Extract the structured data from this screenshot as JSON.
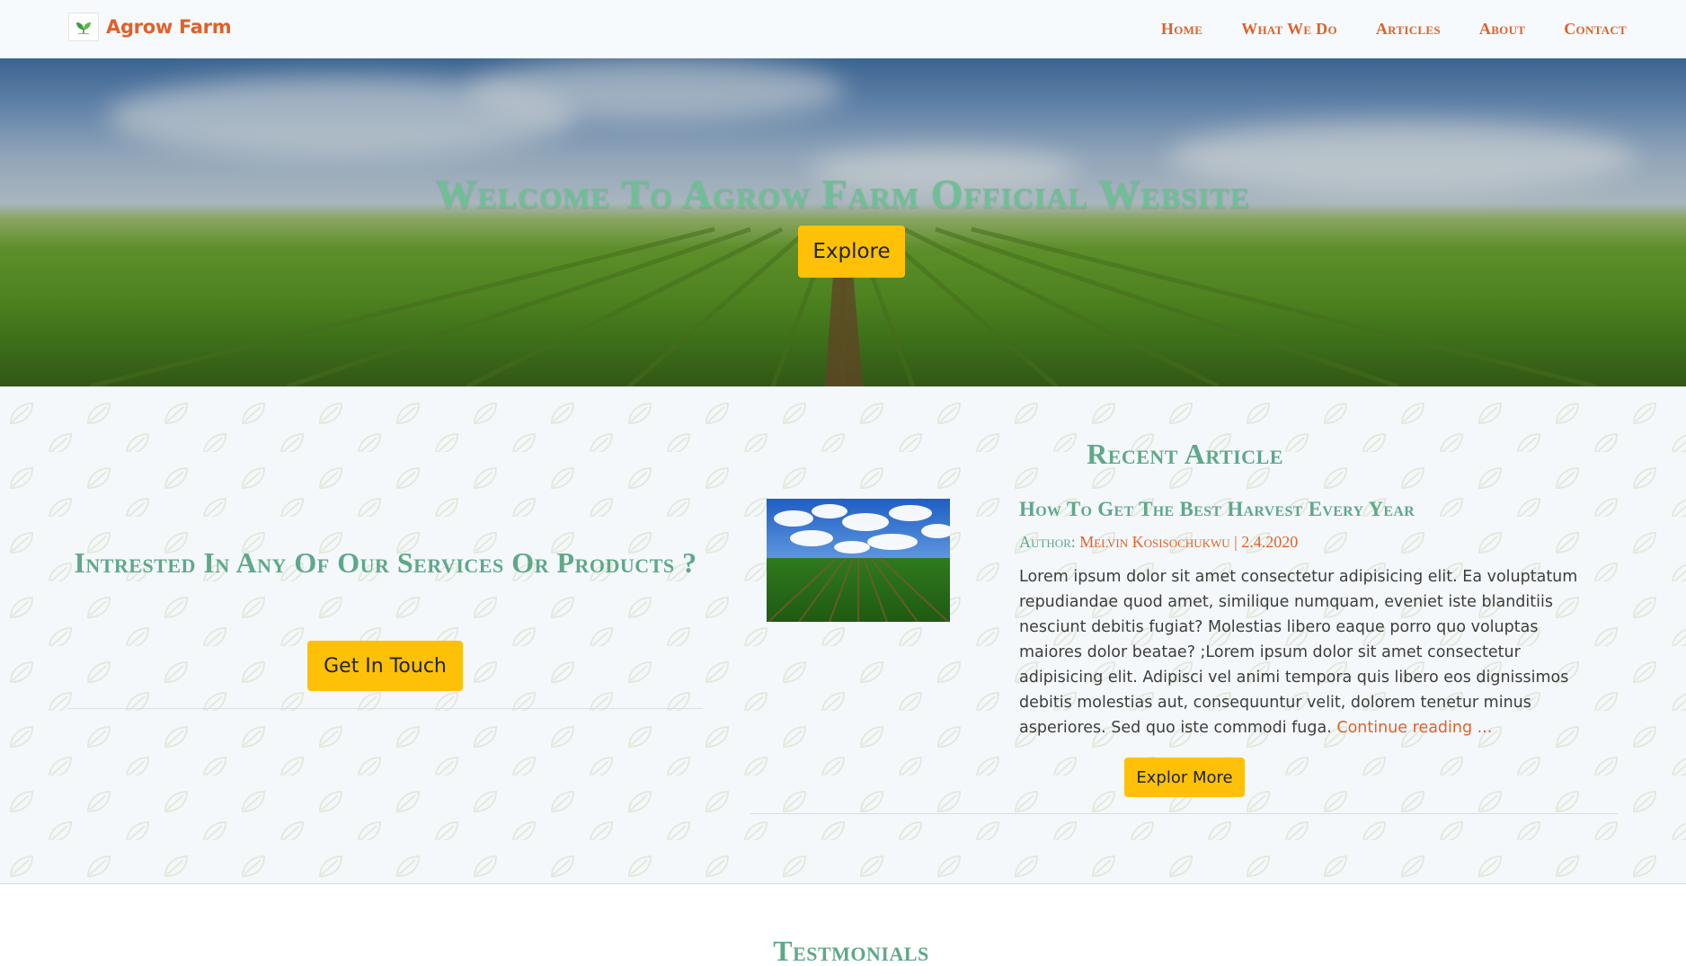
{
  "nav": {
    "brand": "Agrow Farm",
    "links": [
      "Home",
      "What We Do",
      "Articles",
      "About",
      "Contact"
    ]
  },
  "hero": {
    "title": "Welcome To Agrow Farm Official Website",
    "button": "Explore"
  },
  "cta": {
    "title": "Intrested In Any Of Our Services Or Products ?",
    "button": "Get In Touch"
  },
  "recent_article": {
    "section_title": "Recent Article",
    "heading": "How To Get The Best Harvest Every Year",
    "author_label": "Author:",
    "author": "Melvin Kosisochukwu",
    "separator": "|",
    "date": "2.4.2020",
    "body": "Lorem ipsum dolor sit amet consectetur adipisicing elit. Ea voluptatum repudiandae quod amet, similique numquam, eveniet iste blanditiis nesciunt debitis fugiat? Molestias libero eaque porro quo voluptas maiores dolor beatae? ;Lorem ipsum dolor sit amet consectetur adipisicing elit. Adipisci vel animi tempora quis libero eos dignissimos debitis molestias aut, consequuntur velit, dolorem tenetur minus asperiores. Sed quo iste commodi fuga.",
    "continue_link": "Continue reading ...",
    "button": "Explor More"
  },
  "testimonials": {
    "title": "Testmonials"
  },
  "colors": {
    "brand_orange": "#e0612a",
    "heading_green": "#5fa889",
    "button_yellow": "#ffc107",
    "section_bg": "#f4f8fb"
  },
  "icons": {
    "brand_logo": "leaf-logo-icon"
  }
}
